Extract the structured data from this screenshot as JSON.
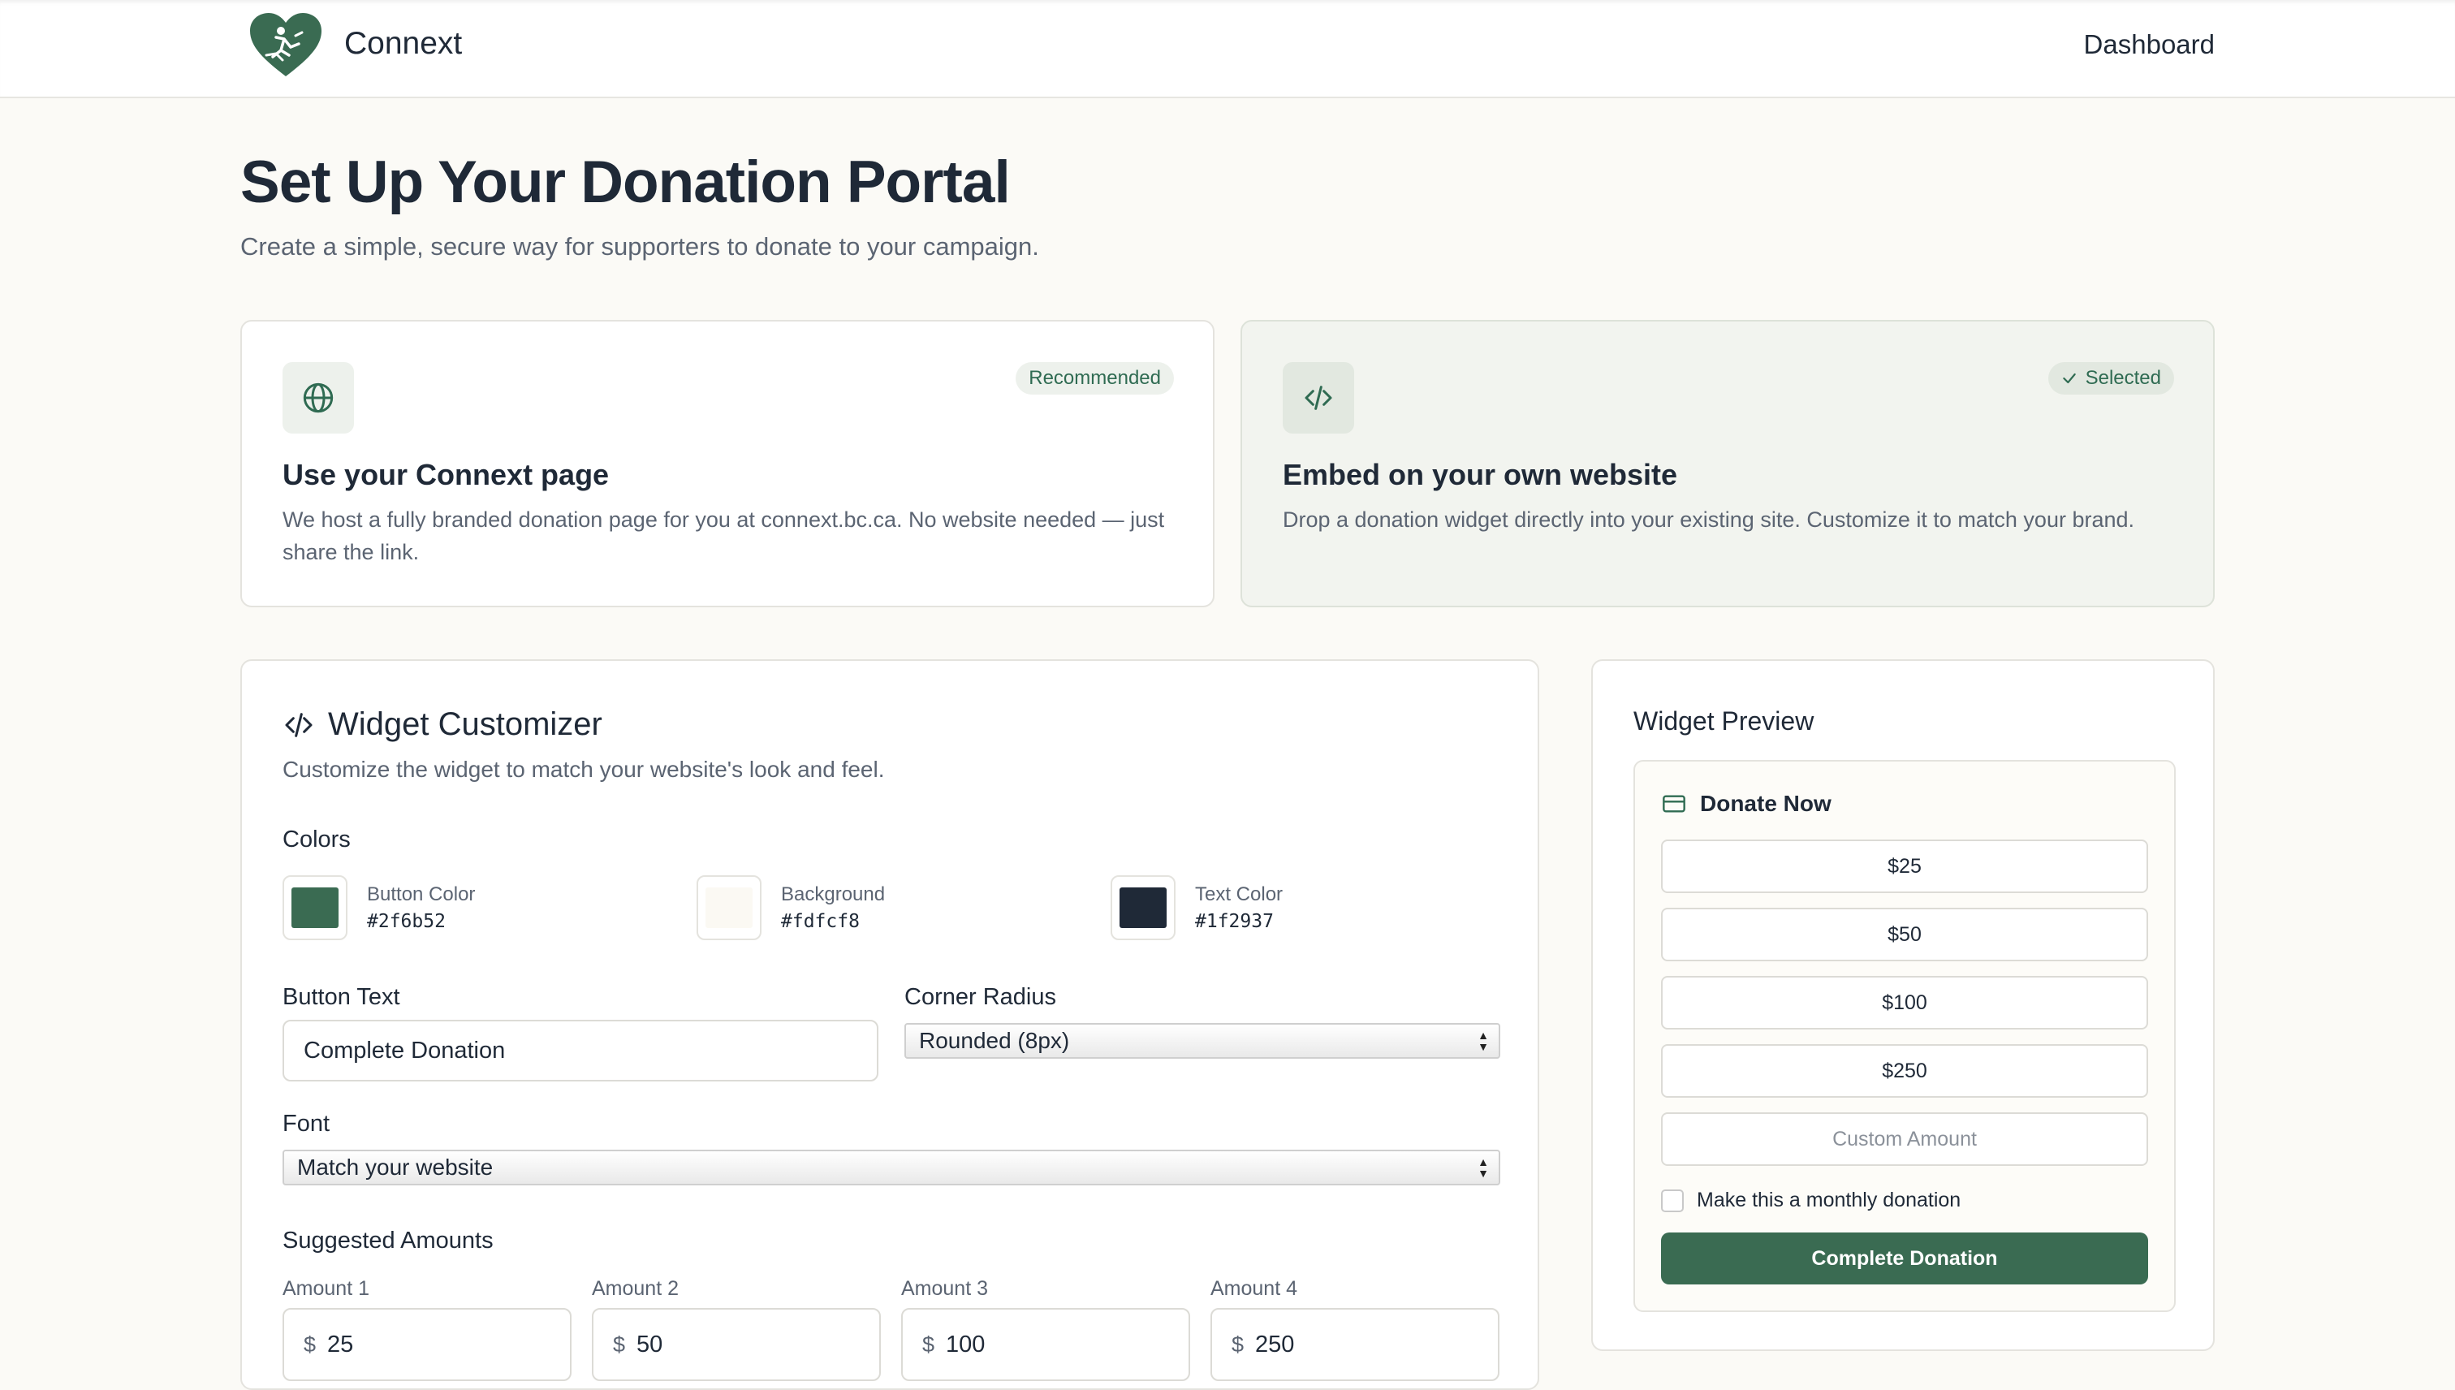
{
  "header": {
    "brand": "Connext",
    "nav_dashboard": "Dashboard"
  },
  "page": {
    "title": "Set Up Your Donation Portal",
    "subtitle": "Create a simple, secure way for supporters to donate to your campaign."
  },
  "options": [
    {
      "title": "Use your Connext page",
      "description": "We host a fully branded donation page for you at connext.bc.ca. No website needed — just share the link.",
      "badge": "Recommended",
      "icon": "globe-icon",
      "selected": false
    },
    {
      "title": "Embed on your own website",
      "description": "Drop a donation widget directly into your existing site. Customize it to match your brand.",
      "badge": "Selected",
      "icon": "code-icon",
      "selected": true
    }
  ],
  "customizer": {
    "title": "Widget Customizer",
    "subtitle": "Customize the widget to match your website's look and feel.",
    "colors_label": "Colors",
    "colors": [
      {
        "name": "Button Color",
        "hex": "#2f6b52"
      },
      {
        "name": "Background",
        "hex": "#fdfcf8"
      },
      {
        "name": "Text Color",
        "hex": "#1f2937"
      }
    ],
    "button_text_label": "Button Text",
    "button_text_value": "Complete Donation",
    "corner_radius_label": "Corner Radius",
    "corner_radius_value": "Rounded (8px)",
    "font_label": "Font",
    "font_value": "Match your website",
    "suggested_label": "Suggested Amounts",
    "currency_symbol": "$",
    "amounts": [
      {
        "label": "Amount 1",
        "value": "25"
      },
      {
        "label": "Amount 2",
        "value": "50"
      },
      {
        "label": "Amount 3",
        "value": "100"
      },
      {
        "label": "Amount 4",
        "value": "250"
      }
    ]
  },
  "preview": {
    "title": "Widget Preview",
    "widget_title": "Donate Now",
    "amount_buttons": [
      "$25",
      "$50",
      "$100",
      "$250"
    ],
    "custom_placeholder": "Custom Amount",
    "monthly_label": "Make this a monthly donation",
    "donate_button": "Complete Donation"
  },
  "theme": {
    "accent": "#2f6b52",
    "accent_button": "#3a6b52",
    "page_bg": "#fbfaf6"
  }
}
